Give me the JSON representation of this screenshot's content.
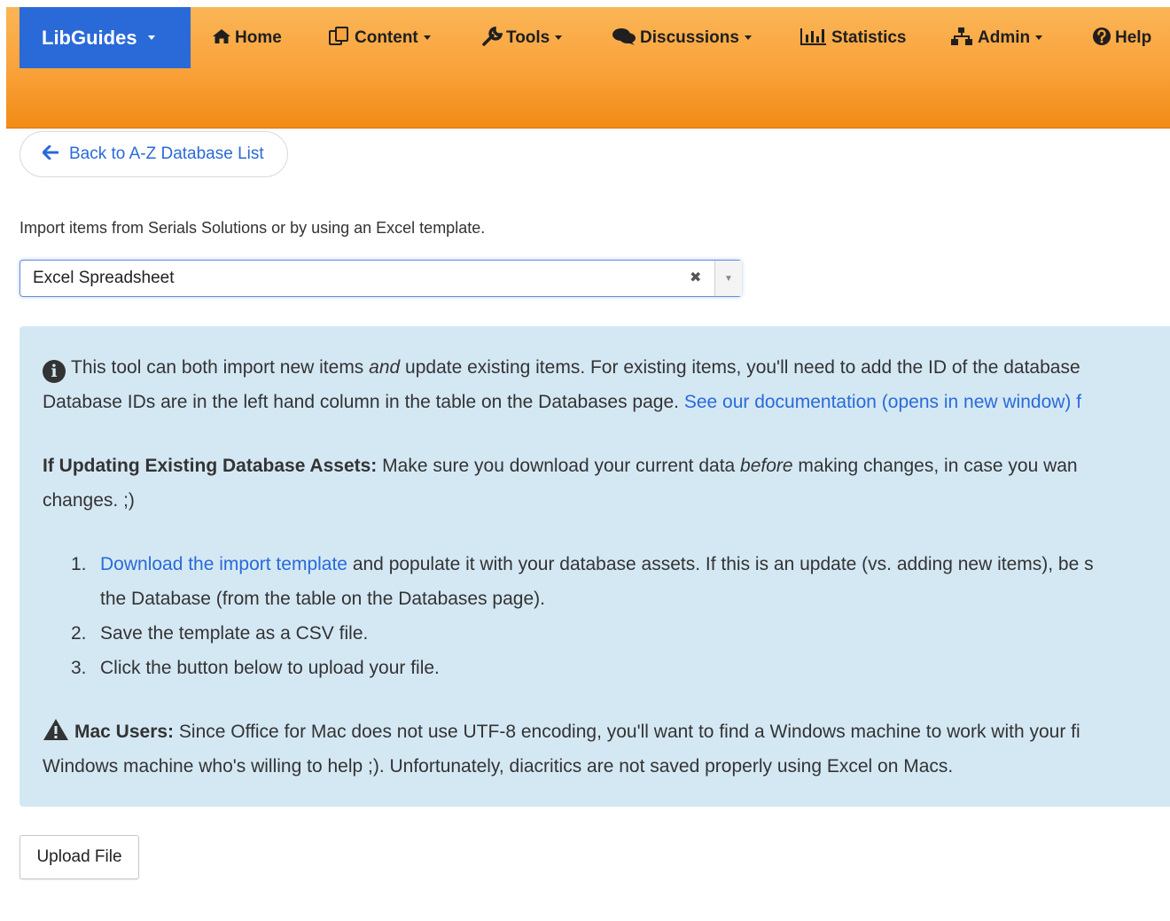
{
  "navbar": {
    "brand": "LibGuides",
    "items": [
      {
        "label": "Home",
        "icon": "home-icon"
      },
      {
        "label": "Content",
        "icon": "content-icon"
      },
      {
        "label": "Tools",
        "icon": "wrench-icon"
      },
      {
        "label": "Discussions",
        "icon": "comments-icon"
      },
      {
        "label": "Statistics",
        "icon": "bar-chart-icon"
      },
      {
        "label": "Admin",
        "icon": "sitemap-icon"
      },
      {
        "label": "Help",
        "icon": "question-circle-icon"
      }
    ]
  },
  "back_button": {
    "label": "Back to A-Z Database List"
  },
  "intro": "Import items from Serials Solutions or by using an Excel template.",
  "select": {
    "value": "Excel Spreadsheet"
  },
  "panel": {
    "p1": {
      "a": "This tool can both import new items ",
      "a_em": "and",
      "b": " update existing items. For existing items, you'll need to add the ID of the database",
      "line2_text": "Database IDs are in the left hand column in the table on the Databases page. ",
      "line2_link": "See our documentation (opens in new window) f"
    },
    "p2": {
      "bold": "If Updating Existing Database Assets:",
      "a": " Make sure you download your current data ",
      "em": "before",
      "b": " making changes, in case you wan",
      "line2": "changes. ;)"
    },
    "steps": [
      {
        "num": "1.",
        "link": "Download the import template",
        "text": " and populate it with your database assets. If this is an update (vs. adding new items), be s",
        "line2": "the Database (from the table on the Databases page)."
      },
      {
        "num": "2.",
        "text": "Save the template as a CSV file."
      },
      {
        "num": "3.",
        "text": "Click the button below to upload your file."
      }
    ],
    "p3": {
      "bold": "Mac Users:",
      "a": " Since Office for Mac does not use UTF-8 encoding, you'll want to find a Windows machine to work with your fi",
      "line2": "Windows machine who's willing to help ;). Unfortunately, diacritics are not saved properly using Excel on Macs."
    }
  },
  "upload_button": {
    "label": "Upload File"
  },
  "colors": {
    "brand": "#2a6ad8",
    "nav_orange": "#f9a33c",
    "panel_bg": "#d4e8f4",
    "link": "#2a6ad8"
  }
}
